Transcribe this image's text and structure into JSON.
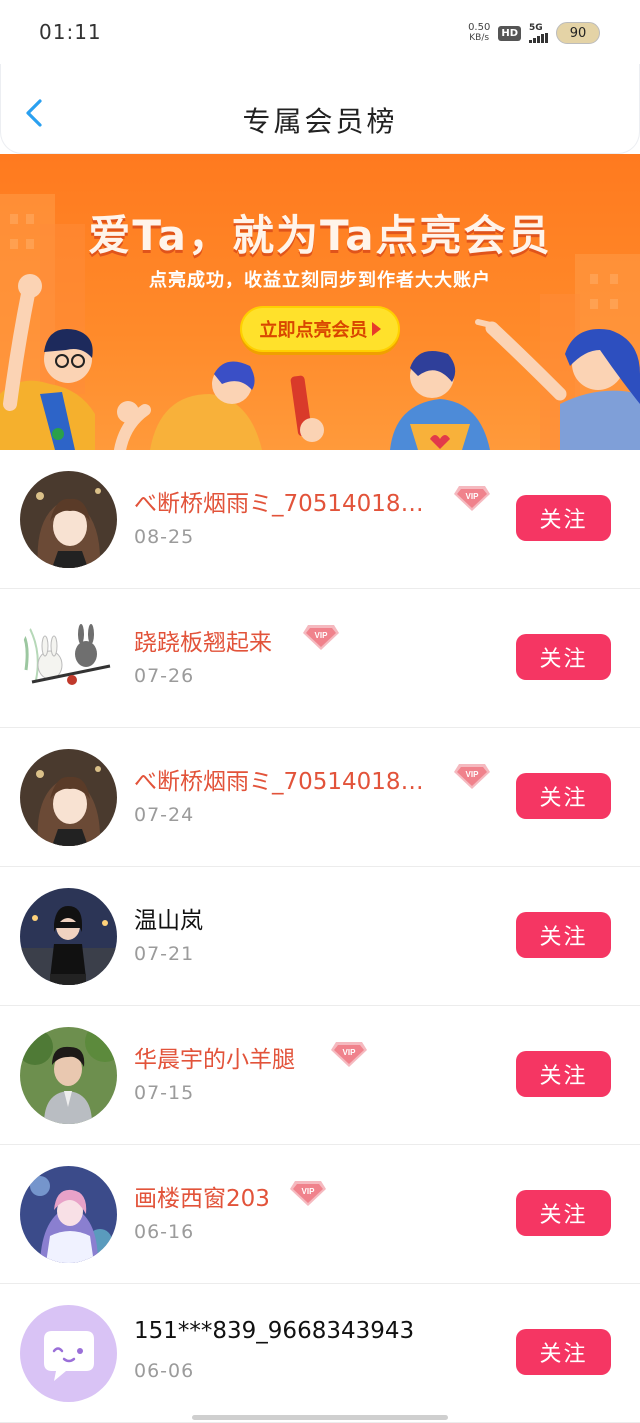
{
  "status_bar": {
    "time": "01:11",
    "net_speed_value": "0.50",
    "net_speed_unit": "KB/s",
    "hd_label": "HD",
    "signal_label": "5G",
    "battery": "90"
  },
  "header": {
    "title": "专属会员榜",
    "back_icon": "chevron-left-icon"
  },
  "banner": {
    "headline": "爱Ta，就为Ta点亮会员",
    "subtitle": "点亮成功，收益立刻同步到作者大大账户",
    "cta_label": "立即点亮会员",
    "colors": {
      "background": "#ff7a1f",
      "cta_background": "#ffe12b",
      "cta_text": "#d94600"
    }
  },
  "members": [
    {
      "name": "べ断桥烟雨ミ_70514018…",
      "date": "08-25",
      "vip": true,
      "follow_label": "关注",
      "avatar": "anime-girl-avatar"
    },
    {
      "name": "跷跷板翘起来",
      "date": "07-26",
      "vip": true,
      "follow_label": "关注",
      "avatar": "rabbits-seesaw-avatar"
    },
    {
      "name": "べ断桥烟雨ミ_70514018…",
      "date": "07-24",
      "vip": true,
      "follow_label": "关注",
      "avatar": "anime-girl-avatar"
    },
    {
      "name": "温山岚",
      "date": "07-21",
      "vip": false,
      "follow_label": "关注",
      "avatar": "night-street-girl-avatar"
    },
    {
      "name": "华晨宇的小羊腿",
      "date": "07-15",
      "vip": true,
      "follow_label": "关注",
      "avatar": "boy-photo-avatar"
    },
    {
      "name": "画楼西窗203",
      "date": "06-16",
      "vip": true,
      "follow_label": "关注",
      "avatar": "anime-art-avatar"
    },
    {
      "name": "151***839_9668343943",
      "date": "06-06",
      "vip": false,
      "follow_label": "关注",
      "avatar": "default-chat-avatar"
    }
  ],
  "vip_badge_text": "VIP",
  "colors": {
    "vip_name": "#e2533a",
    "follow_button": "#f53663",
    "date_text": "#9b9b9b"
  }
}
